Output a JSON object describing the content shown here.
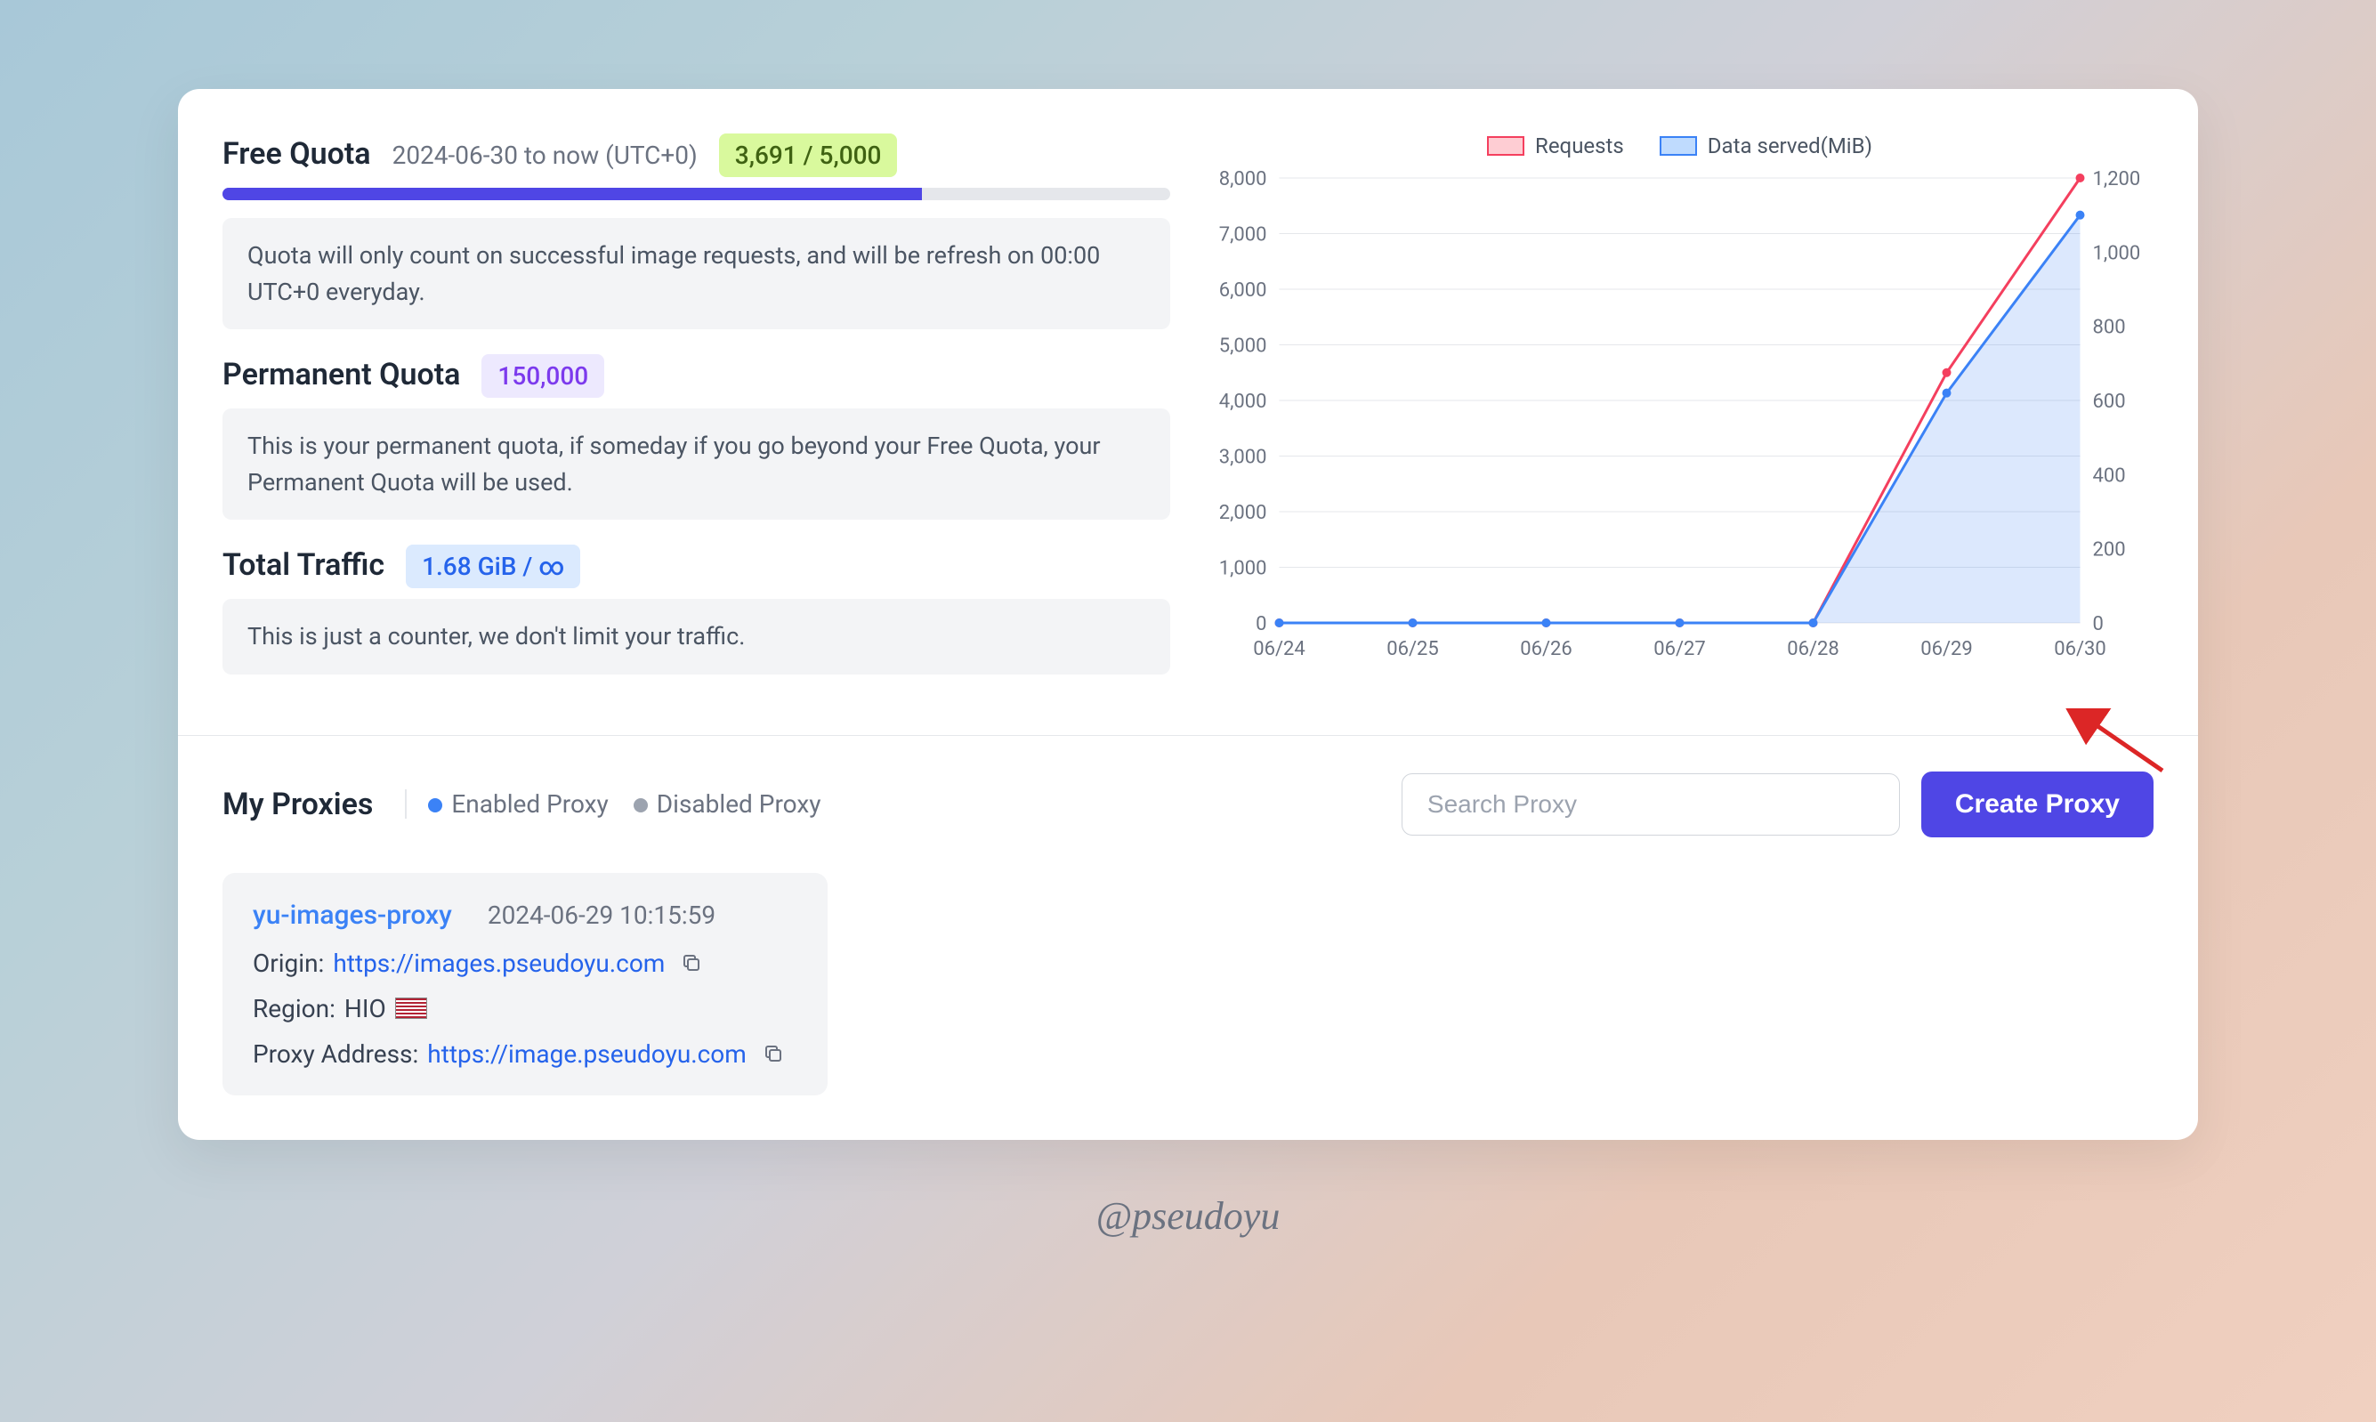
{
  "free_quota": {
    "title": "Free Quota",
    "date_range": "2024-06-30 to now (UTC+0)",
    "badge": "3,691 / 5,000",
    "progress_pct": 73.8,
    "info": "Quota will only count on successful image requests, and will be refresh on 00:00 UTC+0 everyday."
  },
  "permanent_quota": {
    "title": "Permanent Quota",
    "badge": "150,000",
    "info": "This is your permanent quota, if someday if you go beyond your Free Quota, your Permanent Quota will be used."
  },
  "total_traffic": {
    "title": "Total Traffic",
    "badge": "1.68 GiB / ∞",
    "info": "This is just a counter, we don't limit your traffic."
  },
  "chart_legend": {
    "requests": "Requests",
    "data_served": "Data served(MiB)"
  },
  "chart_data": {
    "type": "line",
    "x": [
      "06/24",
      "06/25",
      "06/26",
      "06/27",
      "06/28",
      "06/29",
      "06/30"
    ],
    "y_left_label": "",
    "y_right_label": "",
    "y_left_ticks": [
      0,
      1000,
      2000,
      3000,
      4000,
      5000,
      6000,
      7000,
      8000
    ],
    "y_right_ticks": [
      0,
      200,
      400,
      600,
      800,
      1000,
      1200
    ],
    "series": [
      {
        "name": "Requests",
        "color": "#f43f5e",
        "axis": "left",
        "values": [
          0,
          0,
          0,
          0,
          0,
          4500,
          8000
        ]
      },
      {
        "name": "Data served(MiB)",
        "color": "#3b82f6",
        "axis": "right",
        "area": true,
        "values": [
          0,
          0,
          0,
          0,
          0,
          620,
          1100
        ]
      }
    ]
  },
  "proxies": {
    "title": "My Proxies",
    "enabled_label": "Enabled Proxy",
    "disabled_label": "Disabled Proxy",
    "search_placeholder": "Search Proxy",
    "create_label": "Create Proxy",
    "items": [
      {
        "name": "yu-images-proxy",
        "created": "2024-06-29 10:15:59",
        "origin_label": "Origin:",
        "origin": "https://images.pseudoyu.com",
        "region_label": "Region:",
        "region": "HIO",
        "address_label": "Proxy Address:",
        "address": "https://image.pseudoyu.com"
      }
    ]
  },
  "signature": "@pseudoyu"
}
